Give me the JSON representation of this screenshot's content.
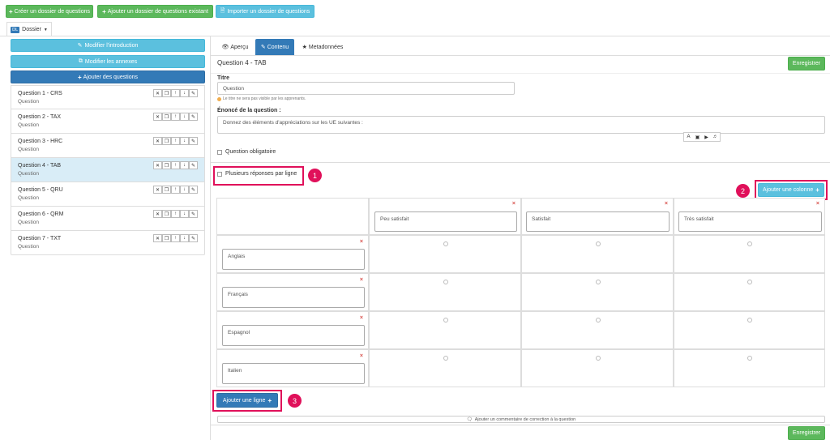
{
  "toolbar": {
    "create_label": "Créer un dossier de questions",
    "add_existing_label": "Ajouter un dossier de questions existant",
    "import_label": "Importer un dossier de questions"
  },
  "dossier_tab": {
    "badge": "DL",
    "label": "Dossier"
  },
  "sidebar": {
    "edit_intro": "Modifier l'introduction",
    "edit_annex": "Modifier les annexes",
    "add_questions": "Ajouter des questions",
    "items": [
      {
        "title": "Question 1 - CRS",
        "sub": "Question"
      },
      {
        "title": "Question 2 - TAX",
        "sub": "Question"
      },
      {
        "title": "Question 3 - HRC",
        "sub": "Question"
      },
      {
        "title": "Question 4 - TAB",
        "sub": "Question"
      },
      {
        "title": "Question 5 - QRU",
        "sub": "Question"
      },
      {
        "title": "Question 6 - QRM",
        "sub": "Question"
      },
      {
        "title": "Question 7 - TXT",
        "sub": "Question"
      }
    ]
  },
  "tabs": {
    "apercu": "Aperçu",
    "contenu": "Contenu",
    "metadonnees": "Metadonnées"
  },
  "main": {
    "heading": "Question 4 - TAB",
    "save": "Enregistrer",
    "titre_label": "Titre",
    "titre_value": "Question",
    "titre_hint": "Le titre ne sera pas visible par les apprenants.",
    "enonce_label": "Énoncé de la question :",
    "enonce_value": "Donnez des éléments d'appréciations sur les UE suivantes :",
    "obligatoire": "Question obligatoire",
    "plusieurs": "Plusieurs réponses par ligne",
    "add_column": "Ajouter une colonne",
    "add_row": "Ajouter une ligne",
    "comment": "Ajouter un commentaire de correction à la question",
    "columns": [
      "Peu satisfait",
      "Satisfait",
      "Très satisfait"
    ],
    "rows": [
      "Anglais",
      "Français",
      "Espagnol",
      "Italien"
    ]
  },
  "annotations": [
    "1",
    "2",
    "3"
  ],
  "colors": {
    "green": "#5cb85c",
    "light_blue": "#5bc0de",
    "dark_blue": "#337ab7",
    "highlight": "#e0105a"
  }
}
